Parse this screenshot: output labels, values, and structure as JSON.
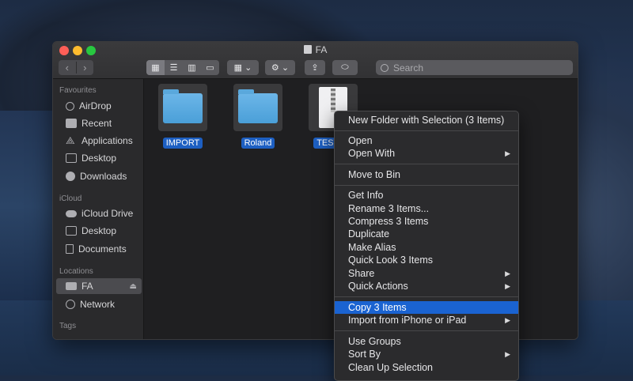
{
  "window": {
    "title": "FA"
  },
  "toolbar": {
    "back_icon": "chevron-left-icon",
    "forward_icon": "chevron-right-icon",
    "search_placeholder": "Search"
  },
  "sidebar": {
    "favourites_header": "Favourites",
    "favourites": [
      {
        "label": "AirDrop",
        "icon": "airdrop-icon"
      },
      {
        "label": "Recent",
        "icon": "recent-icon"
      },
      {
        "label": "Applications",
        "icon": "applications-icon"
      },
      {
        "label": "Desktop",
        "icon": "desktop-icon"
      },
      {
        "label": "Downloads",
        "icon": "downloads-icon"
      }
    ],
    "icloud_header": "iCloud",
    "icloud": [
      {
        "label": "iCloud Drive",
        "icon": "cloud-icon"
      },
      {
        "label": "Desktop",
        "icon": "desktop-icon"
      },
      {
        "label": "Documents",
        "icon": "document-icon"
      }
    ],
    "locations_header": "Locations",
    "locations": [
      {
        "label": "FA",
        "icon": "drive-icon"
      },
      {
        "label": "Network",
        "icon": "network-icon"
      }
    ],
    "tags_header": "Tags"
  },
  "files": [
    {
      "label": "IMPORT",
      "type": "folder"
    },
    {
      "label": "Roland",
      "type": "folder"
    },
    {
      "label": "TEST_S",
      "type": "zip"
    }
  ],
  "context_menu": {
    "items": [
      "New Folder with Selection (3 Items)",
      "Open",
      "Open With",
      "Move to Bin",
      "Get Info",
      "Rename 3 Items...",
      "Compress 3 Items",
      "Duplicate",
      "Make Alias",
      "Quick Look 3 Items",
      "Share",
      "Quick Actions",
      "Copy 3 Items",
      "Import from iPhone or iPad",
      "Use Groups",
      "Sort By",
      "Clean Up Selection"
    ],
    "highlighted": "Copy 3 Items"
  }
}
